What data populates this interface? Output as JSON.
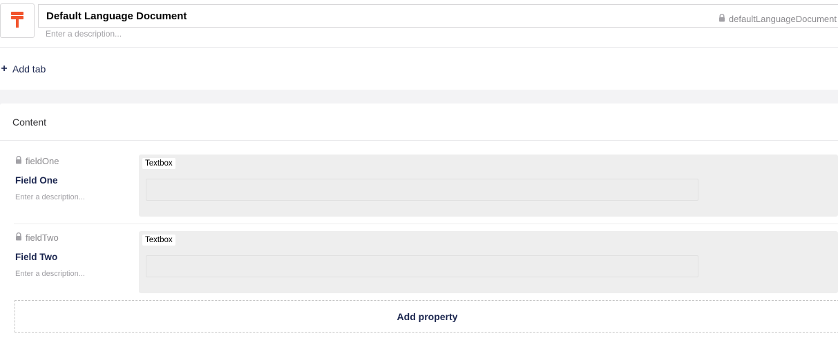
{
  "document_type": {
    "name": "Default Language Document",
    "alias": "defaultLanguageDocument",
    "description_placeholder": "Enter a description...",
    "icon": "document-icon",
    "icon_color": "#f2542d"
  },
  "add_tab_label": "Add tab",
  "group": {
    "title": "Content",
    "properties": [
      {
        "alias": "fieldOne",
        "label": "Field One",
        "description_placeholder": "Enter a description...",
        "editor": "Textbox"
      },
      {
        "alias": "fieldTwo",
        "label": "Field Two",
        "description_placeholder": "Enter a description...",
        "editor": "Textbox"
      }
    ],
    "add_property_label": "Add property"
  },
  "colors": {
    "text_primary": "#1b264f",
    "muted": "#8b8a8e",
    "editor_bg": "#eeeeee",
    "band_bg": "#f3f3f5"
  }
}
